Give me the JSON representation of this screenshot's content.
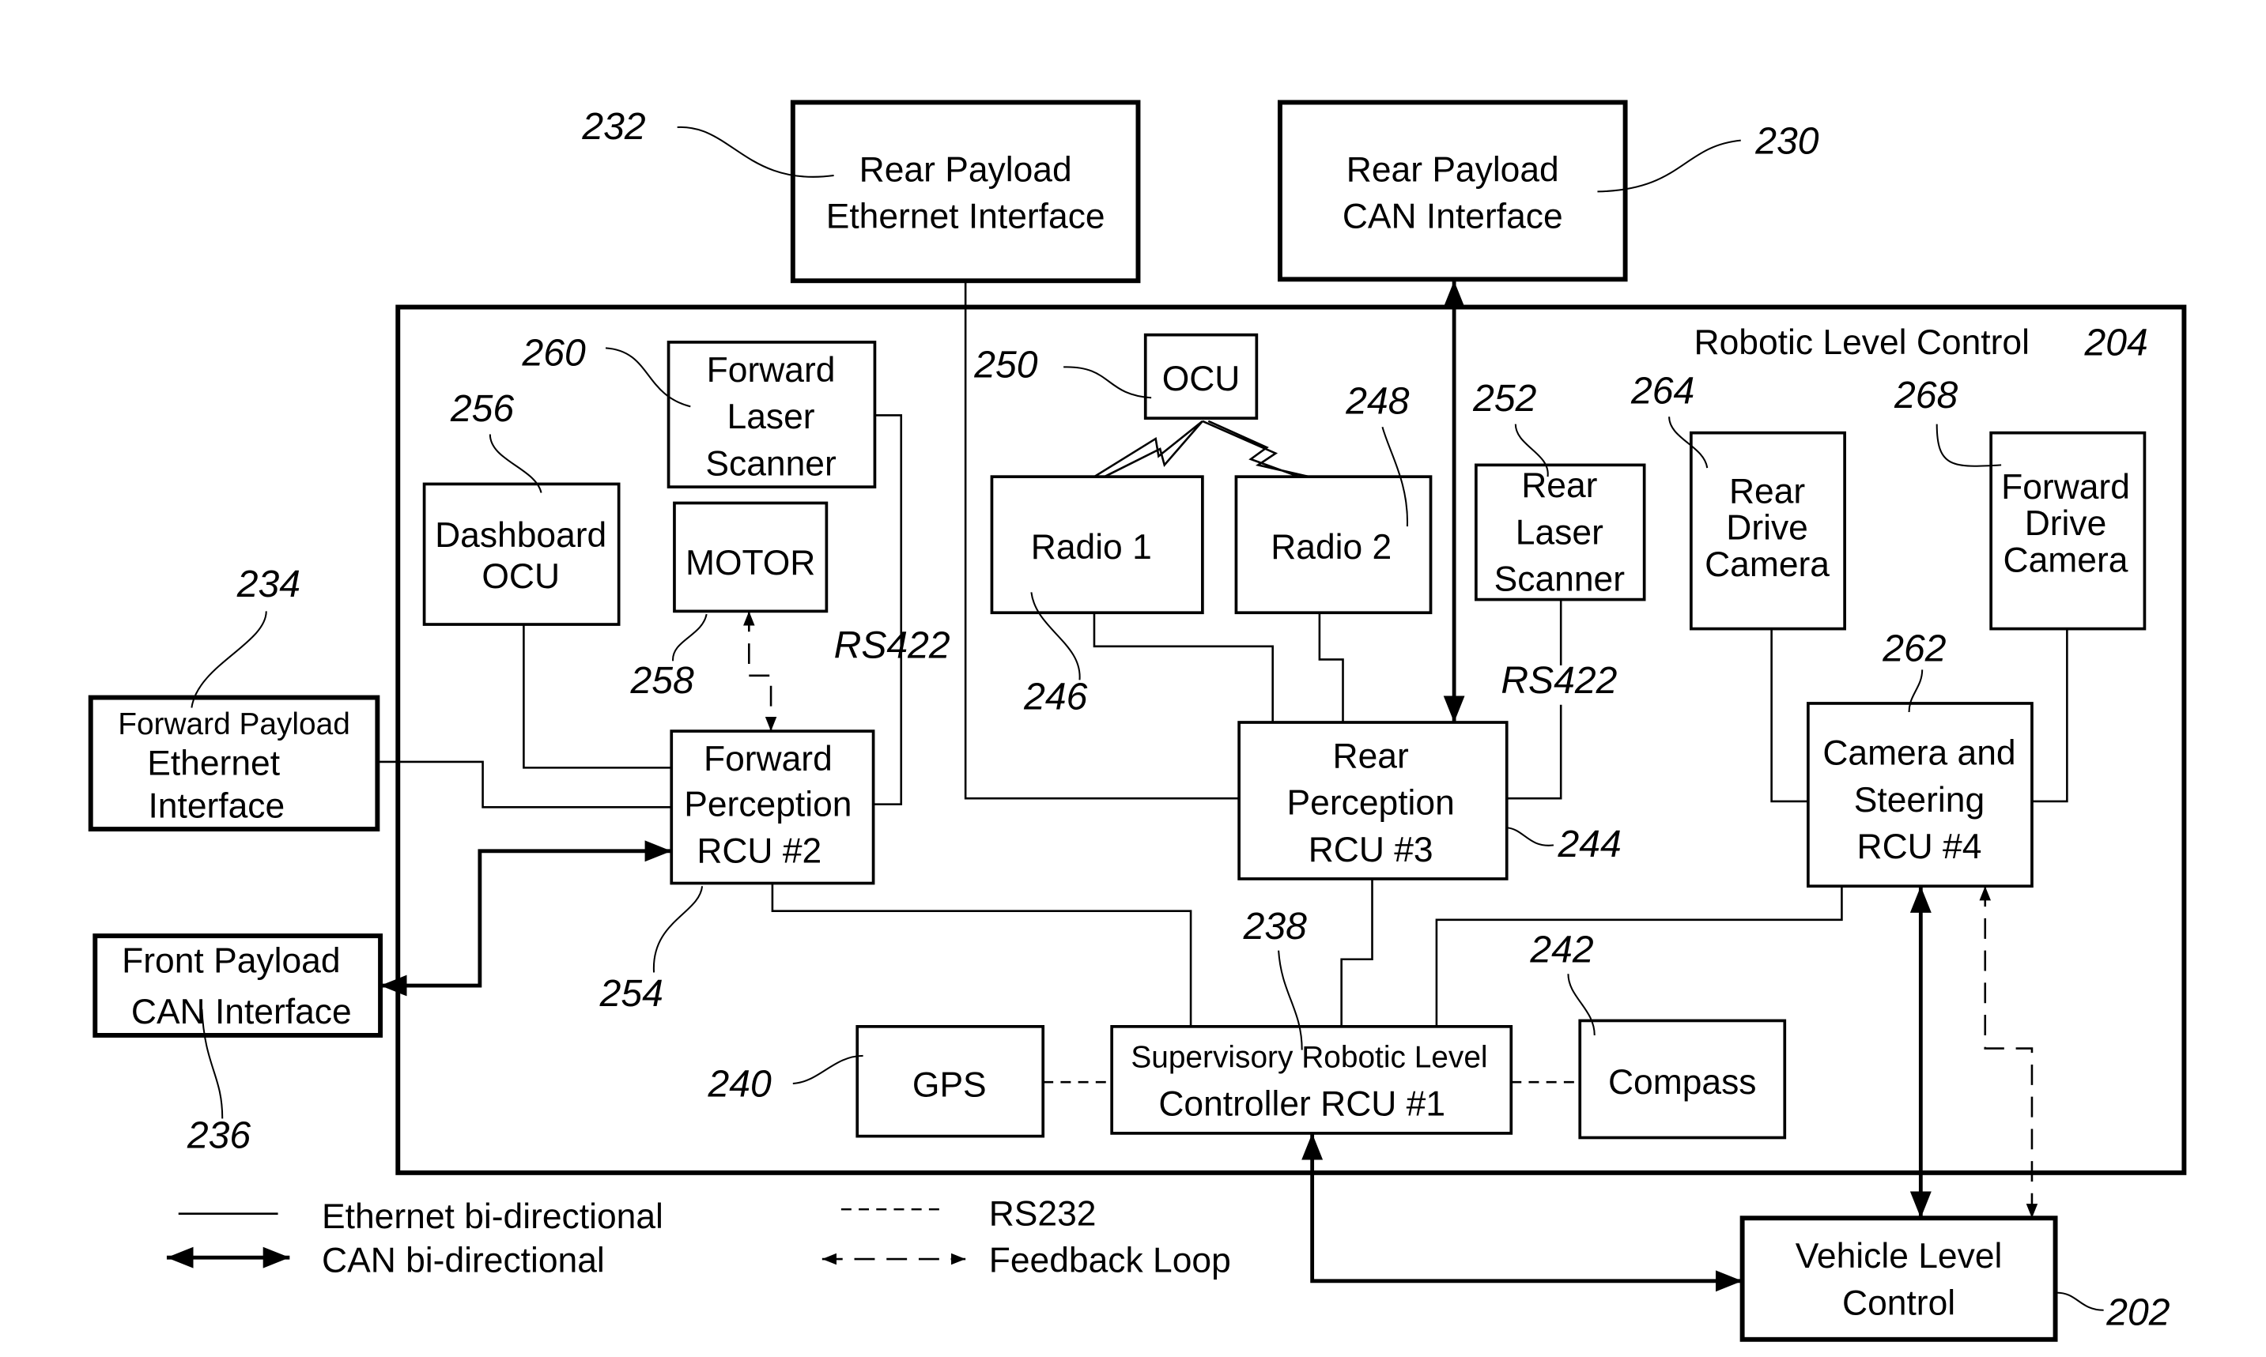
{
  "figure": {
    "container": {
      "title": "Robotic Level Control",
      "ref": "204"
    },
    "blocks": {
      "rear_payload_ethernet": {
        "lines": [
          "Rear Payload",
          "Ethernet Interface"
        ],
        "ref": "232"
      },
      "rear_payload_can": {
        "lines": [
          "Rear Payload",
          "CAN Interface"
        ],
        "ref": "230"
      },
      "forward_laser_scanner": {
        "lines": [
          "Forward",
          "Laser",
          "Scanner"
        ],
        "ref": "260"
      },
      "dashboard_ocu": {
        "lines": [
          "Dashboard",
          "OCU"
        ],
        "ref": "256"
      },
      "motor": {
        "lines": [
          "MOTOR"
        ],
        "ref": "258"
      },
      "forward_perception": {
        "lines": [
          "Forward",
          "Perception",
          "RCU #2"
        ],
        "ref": "254"
      },
      "ocu": {
        "lines": [
          "OCU"
        ],
        "ref": "250"
      },
      "radio1": {
        "lines": [
          "Radio 1"
        ],
        "ref": "246"
      },
      "radio2": {
        "lines": [
          "Radio 2"
        ],
        "ref": "248"
      },
      "rear_laser_scanner": {
        "lines": [
          "Rear",
          "Laser",
          "Scanner"
        ],
        "ref": "252"
      },
      "rear_drive_camera": {
        "lines": [
          "Rear",
          "Drive",
          "Camera"
        ],
        "ref": "264"
      },
      "forward_drive_camera": {
        "lines": [
          "Forward",
          "Drive",
          "Camera"
        ],
        "ref": "268"
      },
      "rear_perception": {
        "lines": [
          "Rear",
          "Perception",
          "RCU #3"
        ],
        "ref": "244"
      },
      "camera_steering": {
        "lines": [
          "Camera and",
          "Steering",
          "RCU #4"
        ],
        "ref": "262"
      },
      "gps": {
        "lines": [
          "GPS"
        ],
        "ref": "240"
      },
      "supervisory": {
        "lines": [
          "Supervisory Robotic Level",
          "Controller RCU #1"
        ],
        "ref": "238"
      },
      "compass": {
        "lines": [
          "Compass"
        ],
        "ref": "242"
      },
      "forward_payload_ethernet": {
        "lines": [
          "Forward Payload",
          "Ethernet",
          "Interface"
        ],
        "ref": "234"
      },
      "front_payload_can": {
        "lines": [
          "Front Payload",
          "CAN Interface"
        ],
        "ref": "236"
      },
      "vehicle_level_control": {
        "lines": [
          "Vehicle Level",
          "Control"
        ],
        "ref": "202"
      }
    },
    "link_labels": {
      "rs422_forward": "RS422",
      "rs422_rear": "RS422"
    },
    "legend": {
      "ethernet": "Ethernet bi-directional",
      "can": "CAN bi-directional",
      "rs232": "RS232",
      "feedback": "Feedback Loop"
    }
  }
}
